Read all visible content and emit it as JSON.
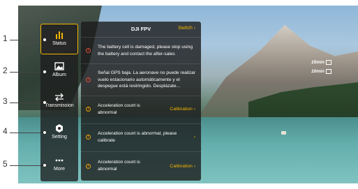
{
  "callouts": [
    "1",
    "2",
    "3",
    "4",
    "5"
  ],
  "sidebar": {
    "tabs": [
      {
        "label": "Status",
        "icon": "status-bars-icon"
      },
      {
        "label": "Album",
        "icon": "album-icon"
      },
      {
        "label": "Transmission",
        "icon": "transmission-arrows-icon"
      },
      {
        "label": "Setting",
        "icon": "hexagon-settings-icon"
      },
      {
        "label": "More",
        "icon": "more-dots-icon"
      }
    ],
    "active_color": "#f3b600"
  },
  "panel": {
    "title": "DJI FPV",
    "switch_label": "Switch",
    "rows": [
      {
        "severity": "red",
        "text": "The battery cell is damaged, please stop using the battery and contact the after-sales",
        "action": ""
      },
      {
        "severity": "red",
        "text": "Señal GPS baja. La aeronave no puede realizar vuelo estacionario automáticamente y el despegue está restringido. Desplázate...",
        "action": ""
      },
      {
        "severity": "amber",
        "text": "Acceleration count is abnormal",
        "action": "Calibration"
      },
      {
        "severity": "amber",
        "text": "Acceleration count is abnormal, please calibrate",
        "action": ""
      },
      {
        "severity": "amber",
        "text": "Acceleration count is abnormal",
        "action": "Calibration"
      }
    ]
  },
  "osd": {
    "line1": "15min",
    "line2": "10min"
  }
}
